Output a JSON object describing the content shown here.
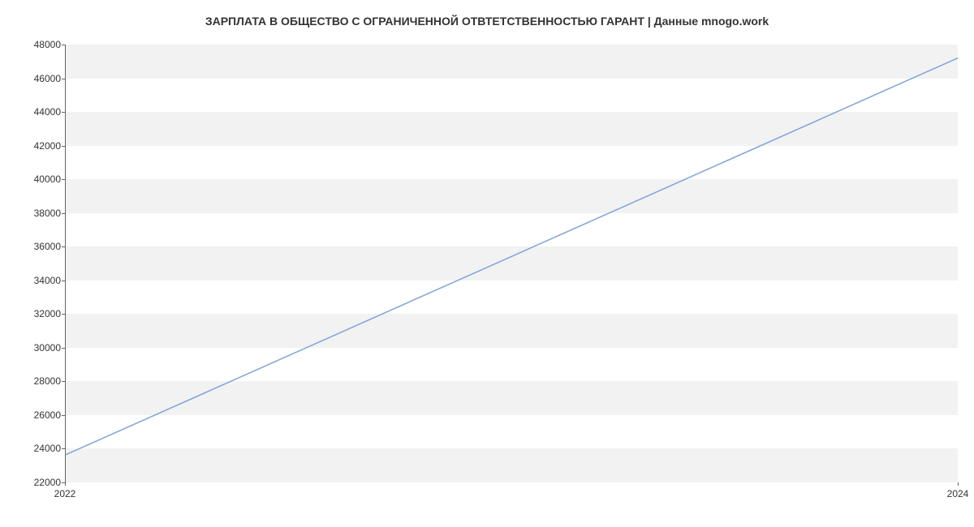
{
  "chart_data": {
    "type": "line",
    "title": "ЗАРПЛАТА В ОБЩЕСТВО С ОГРАНИЧЕННОЙ ОТВТЕТСТВЕННОСТЬЮ ГАРАНТ | Данные mnogo.work",
    "xlabel": "",
    "ylabel": "",
    "x": [
      2022,
      2024
    ],
    "values": [
      23600,
      47200
    ],
    "x_ticks": [
      2022,
      2024
    ],
    "y_ticks": [
      22000,
      24000,
      26000,
      28000,
      30000,
      32000,
      34000,
      36000,
      38000,
      40000,
      42000,
      44000,
      46000,
      48000
    ],
    "xlim": [
      2022,
      2024
    ],
    "ylim": [
      22000,
      48000
    ],
    "line_color": "#7fa3d8",
    "band_color": "#f2f2f2"
  }
}
